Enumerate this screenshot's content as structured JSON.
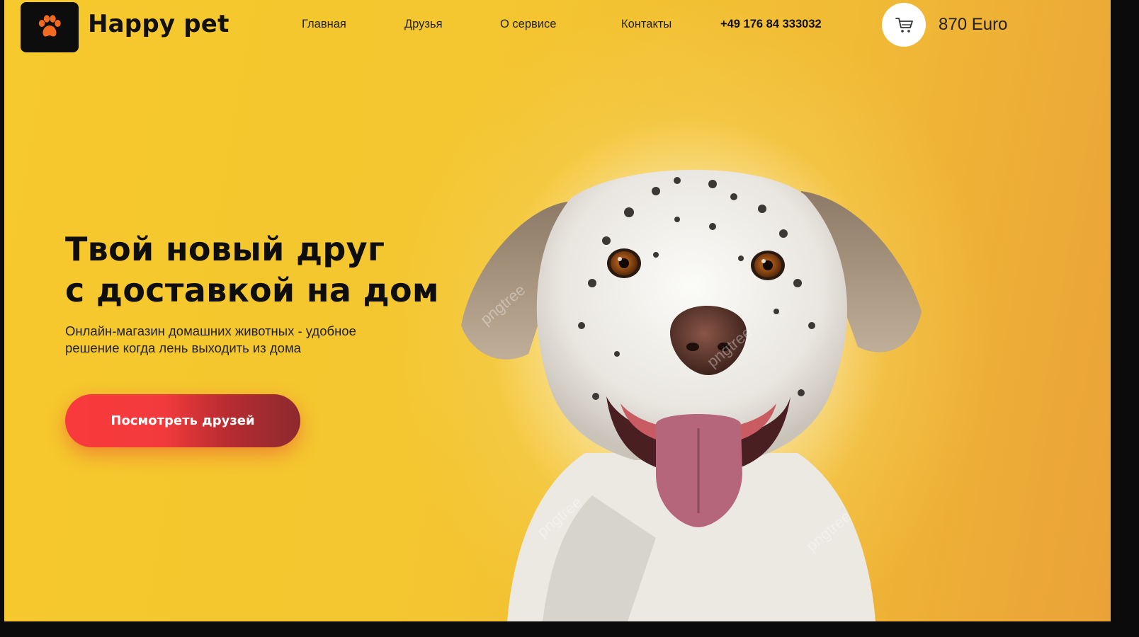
{
  "header": {
    "brand": "Happy pet",
    "nav": [
      "Главная",
      "Друзья",
      "О сервисе",
      "Контакты"
    ],
    "phone": "+49 176 84 333032",
    "cart_total": "870 Euro"
  },
  "hero": {
    "title_line1": "Твой новый друг",
    "title_line2": "с доставкой на дом",
    "subtitle": "Онлайн-магазин домашних животных - удобное решение когда лень выходить из дома",
    "cta_label": "Посмотреть друзей"
  },
  "image": {
    "watermark": "pngtree"
  },
  "colors": {
    "background": "#f4c630",
    "accent": "#f83a3c",
    "logo_bg": "#0d0d0d",
    "paw": "#f26a1f"
  },
  "icons": [
    "paw-icon",
    "cart-icon"
  ]
}
